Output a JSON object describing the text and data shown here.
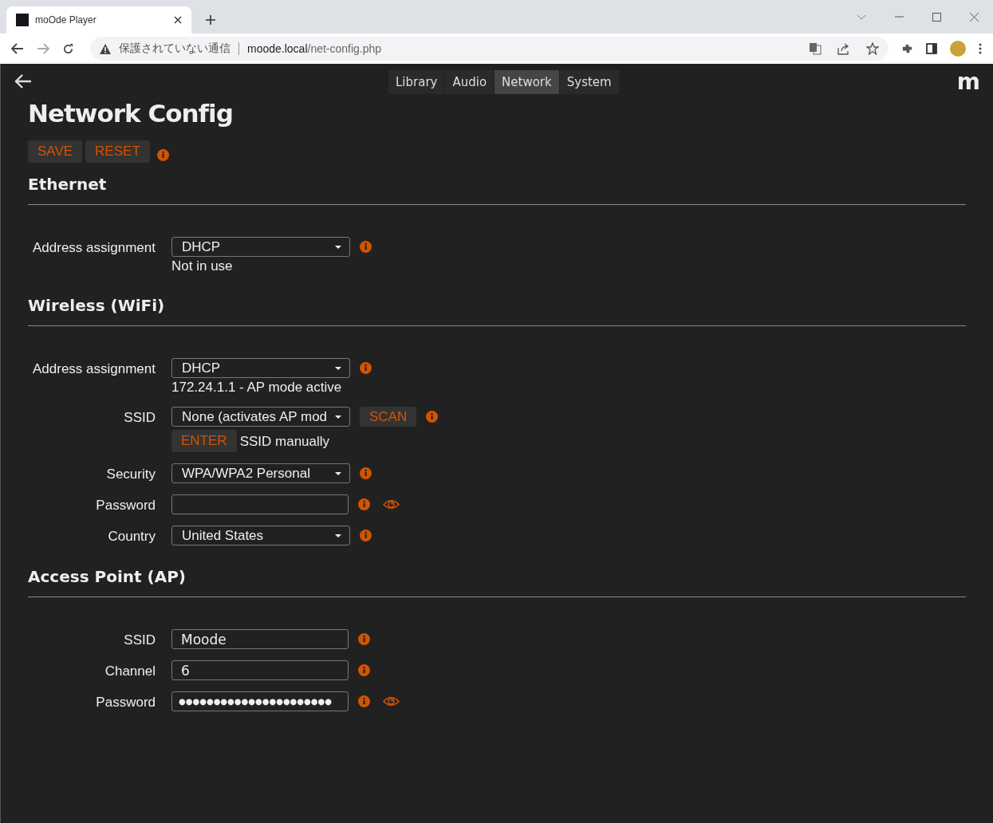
{
  "browser": {
    "tab_title": "moOde Player",
    "security_warning": "保護されていない通信",
    "url_host": "moode.local",
    "url_path": "/net-config.php"
  },
  "nav": {
    "tabs": [
      {
        "label": "Library",
        "selected": false
      },
      {
        "label": "Audio",
        "selected": false
      },
      {
        "label": "Network",
        "selected": true
      },
      {
        "label": "System",
        "selected": false
      }
    ],
    "logo": "m"
  },
  "page_title": "Network Config",
  "actions": [
    "SAVE",
    "RESET"
  ],
  "sections": [
    {
      "title": "Ethernet",
      "rows": [
        {
          "label": "Address assignment",
          "kind": "select",
          "value": "DHCP",
          "note": "Not in use"
        }
      ]
    },
    {
      "title": "Wireless (WiFi)",
      "rows": [
        {
          "label": "Address assignment",
          "kind": "select",
          "value": "DHCP",
          "note": "172.24.1.1 - AP mode active"
        },
        {
          "label": "SSID",
          "kind": "select",
          "value": "None (activates AP mod",
          "side_button": "SCAN",
          "enter_button": "ENTER",
          "enter_text": "SSID manually"
        },
        {
          "label": "Security",
          "kind": "select",
          "value": "WPA/WPA2 Personal"
        },
        {
          "label": "Password",
          "kind": "password",
          "value": "",
          "show_toggle": true
        },
        {
          "label": "Country",
          "kind": "select",
          "value": "United States"
        }
      ]
    },
    {
      "title": "Access Point (AP)",
      "rows": [
        {
          "label": "SSID",
          "kind": "input",
          "value": "Moode"
        },
        {
          "label": "Channel",
          "kind": "input",
          "value": "6"
        },
        {
          "label": "Password",
          "kind": "password",
          "value": "●●●●●●●●●●●●●●●●●●●●●●",
          "show_toggle": true
        }
      ]
    }
  ]
}
